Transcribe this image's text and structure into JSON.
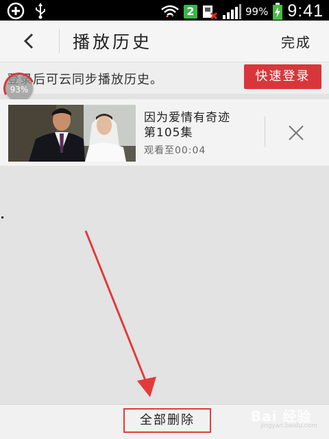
{
  "status_bar": {
    "badge": "2",
    "battery": "99%",
    "time": "9:41",
    "icons": [
      "add-circle-icon",
      "usb-icon",
      "wifi-icon",
      "sim-error-icon",
      "signal-icon",
      "battery-charging-icon"
    ]
  },
  "header": {
    "title": "播放历史",
    "done_label": "完成"
  },
  "login_bar": {
    "text": "登录后可云同步播放历史。",
    "button_label": "快速登录",
    "progress": "93%"
  },
  "history": [
    {
      "title_line1": "因为爱情有奇迹",
      "title_line2": "第105集",
      "watched": "观看至00:04"
    }
  ],
  "bottom": {
    "delete_all_label": "全部删除",
    "watermark": "Bai 经验",
    "watermark_sub": "jingyan.baidu.com"
  },
  "colors": {
    "accent": "#d9363b",
    "annotation": "#e23a3a",
    "background": "#e3e3e3"
  }
}
